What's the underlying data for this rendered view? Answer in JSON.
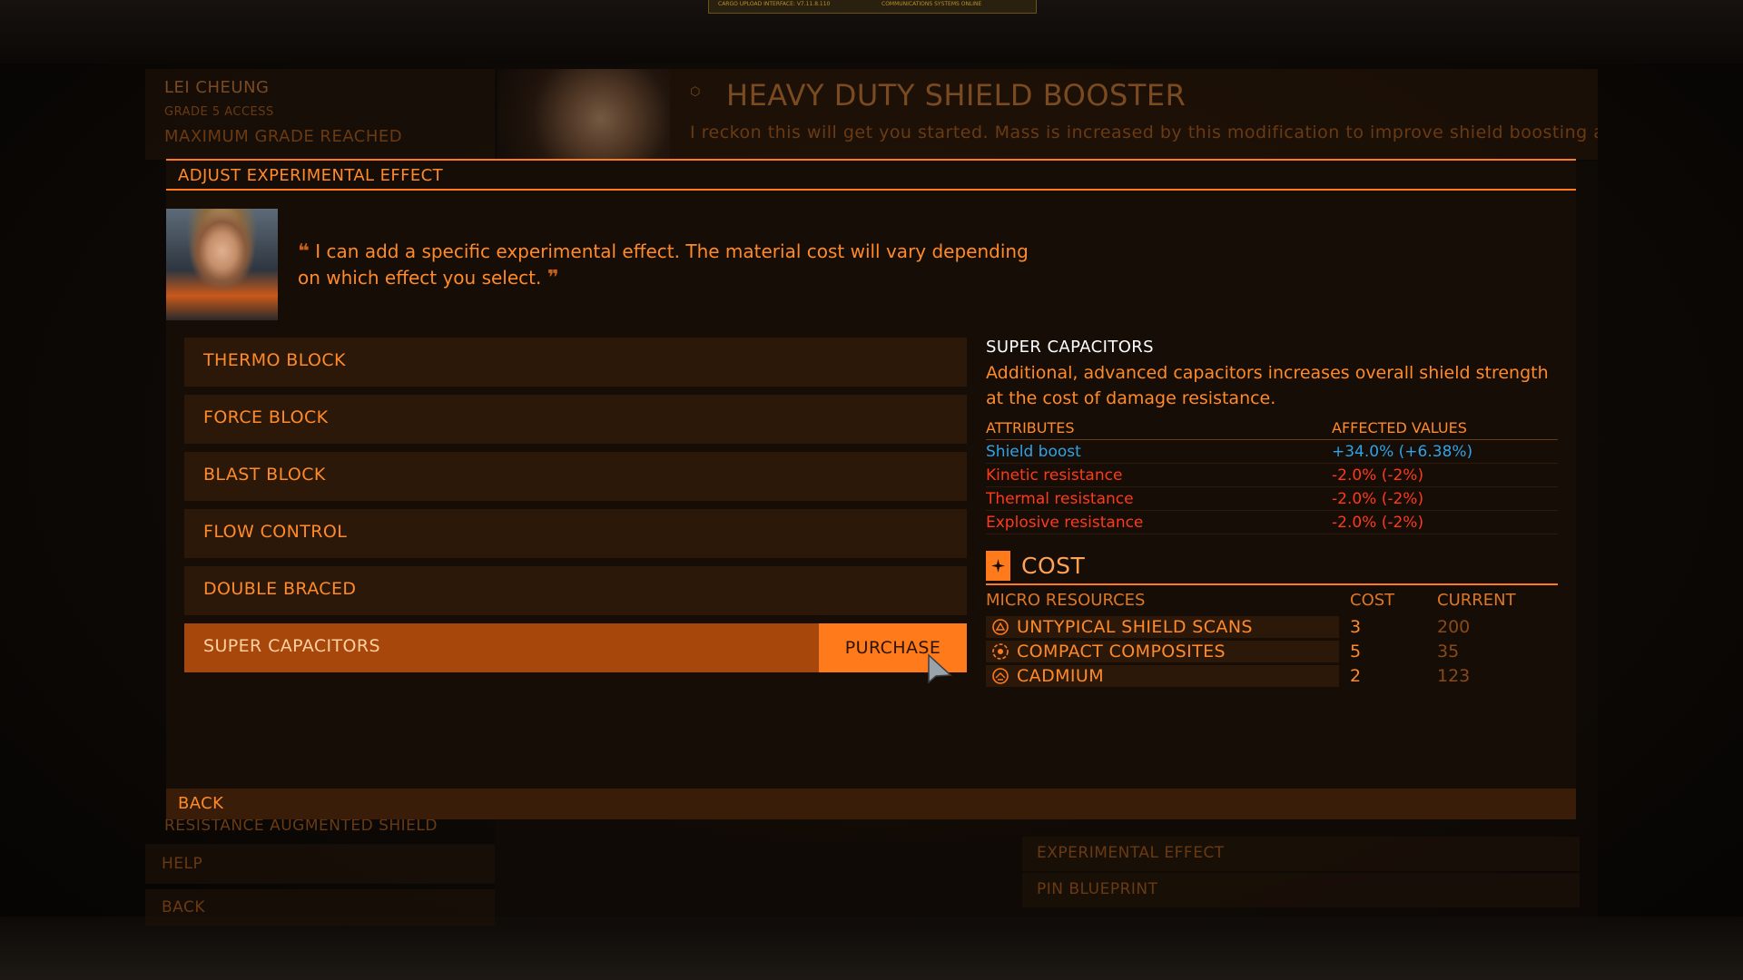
{
  "background": {
    "top_plate_left": "CARGO UPLOAD INTERFACE: V7.11.8.110",
    "top_plate_right": "COMMUNICATIONS SYSTEMS ONLINE",
    "engineer_name": "LEI CHEUNG",
    "access_grade": "GRADE 5 ACCESS",
    "grade_status": "MAXIMUM GRADE REACHED",
    "blueprint_title": "HEAVY DUTY SHIELD BOOSTER",
    "blueprint_quote": "I reckon this will get you started. Mass is increased by this modification to improve shield boosting and module integrity. Way better than stock, but it only goes so far.",
    "left_items": [
      "RESISTANCE AUGMENTED SHIELD",
      "HELP",
      "BACK"
    ],
    "right_items": [
      "EXPERIMENTAL EFFECT",
      "PIN BLUEPRINT"
    ]
  },
  "modal": {
    "header": "ADJUST EXPERIMENTAL EFFECT",
    "quote": "I can add a specific experimental effect. The material cost will vary depending on which effect you select.",
    "effects": [
      {
        "label": "THERMO BLOCK",
        "selected": false
      },
      {
        "label": "FORCE BLOCK",
        "selected": false
      },
      {
        "label": "BLAST BLOCK",
        "selected": false
      },
      {
        "label": "FLOW CONTROL",
        "selected": false
      },
      {
        "label": "DOUBLE BRACED",
        "selected": false
      },
      {
        "label": "SUPER CAPACITORS",
        "selected": true
      }
    ],
    "purchase_label": "PURCHASE",
    "back_label": "BACK"
  },
  "details": {
    "title": "SUPER CAPACITORS",
    "description": "Additional, advanced capacitors increases overall shield strength at the cost of damage resistance.",
    "attr_header": "ATTRIBUTES",
    "value_header": "AFFECTED VALUES",
    "attributes": [
      {
        "name": "Shield boost",
        "value": "+34.0% (+6.38%)",
        "effect": "positive"
      },
      {
        "name": "Kinetic resistance",
        "value": "-2.0% (-2%)",
        "effect": "negative"
      },
      {
        "name": "Thermal resistance",
        "value": "-2.0% (-2%)",
        "effect": "negative"
      },
      {
        "name": "Explosive resistance",
        "value": "-2.0% (-2%)",
        "effect": "negative"
      }
    ]
  },
  "cost": {
    "title": "COST",
    "col_resources": "MICRO RESOURCES",
    "col_cost": "COST",
    "col_current": "CURRENT",
    "items": [
      {
        "name": "UNTYPICAL SHIELD SCANS",
        "cost": "3",
        "current": "200",
        "icon": "data-icon"
      },
      {
        "name": "COMPACT COMPOSITES",
        "cost": "5",
        "current": "35",
        "icon": "manufactured-icon"
      },
      {
        "name": "CADMIUM",
        "cost": "2",
        "current": "123",
        "icon": "raw-material-icon"
      }
    ]
  },
  "colors": {
    "accent": "#ff7a1a",
    "positive": "#2fa3e8",
    "negative": "#ff3a1a"
  }
}
